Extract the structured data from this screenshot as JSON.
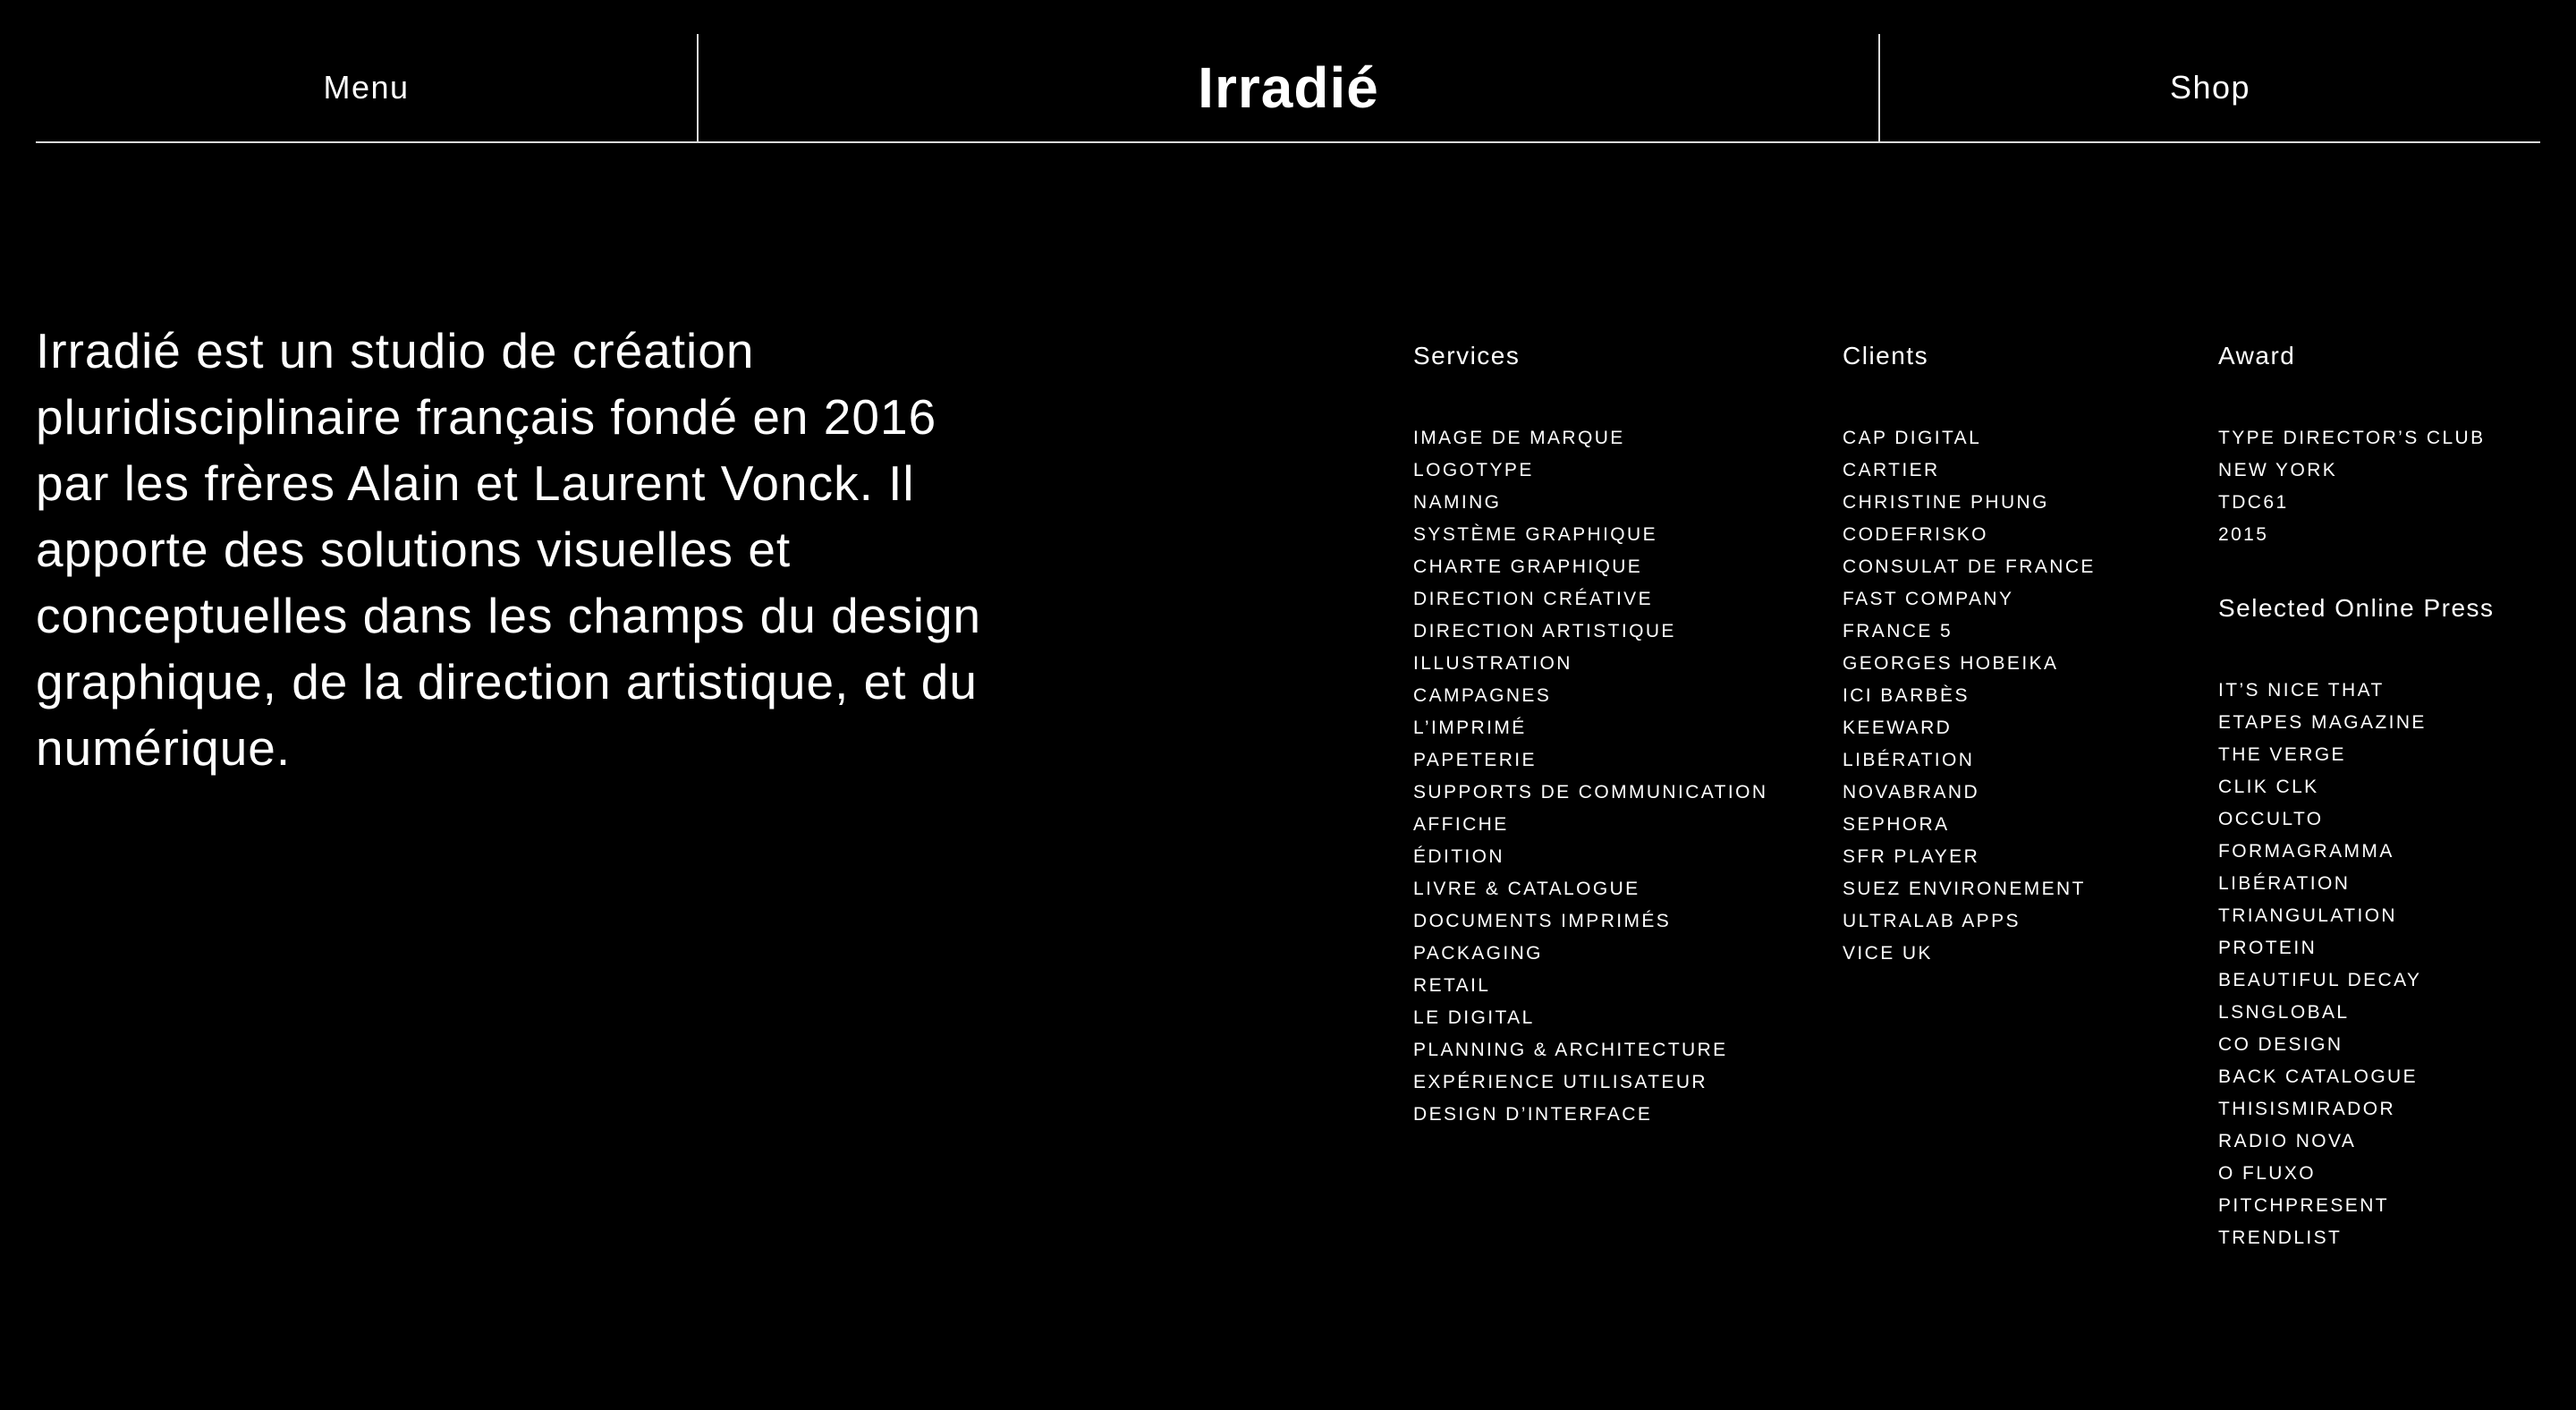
{
  "header": {
    "menu_label": "Menu",
    "logo": "Irradié",
    "shop_label": "Shop"
  },
  "intro": {
    "text": "Irradié est un studio de création pluridisciplinaire français fondé en 2016 par les frères Alain et Laurent Vonck. Il apporte des solutions visuelles et conceptuelles dans les champs du design graphique, de la direction artistique, et du numérique."
  },
  "services": {
    "heading": "Services",
    "groups": [
      [
        "IMAGE DE MARQUE",
        "LOGOTYPE",
        "NAMING",
        "SYSTÈME GRAPHIQUE",
        "CHARTE GRAPHIQUE",
        "DIRECTION CRÉATIVE",
        "DIRECTION ARTISTIQUE",
        "ILLUSTRATION",
        "CAMPAGNES"
      ],
      [
        "L’IMPRIMÉ",
        "PAPETERIE",
        "SUPPORTS DE COMMUNICATION",
        "AFFICHE",
        "ÉDITION",
        "LIVRE & CATALOGUE",
        "DOCUMENTS IMPRIMÉS",
        "PACKAGING",
        "RETAIL"
      ],
      [
        "LE DIGITAL",
        "PLANNING & ARCHITECTURE",
        "EXPÉRIENCE UTILISATEUR",
        "DESIGN D’INTERFACE"
      ]
    ]
  },
  "clients": {
    "heading": "Clients",
    "items": [
      "CAP DIGITAL",
      "CARTIER",
      "CHRISTINE PHUNG",
      "CODEFRISKO",
      "CONSULAT DE FRANCE",
      "FAST COMPANY",
      "FRANCE 5",
      "GEORGES HOBEIKA",
      "ICI BARBÈS",
      "KEEWARD",
      "LIBÉRATION",
      "NOVABRAND",
      "SEPHORA",
      "SFR PLAYER",
      "SUEZ ENVIRONEMENT",
      "ULTRALAB APPS",
      "VICE UK"
    ]
  },
  "award": {
    "heading": "Award",
    "items": [
      "TYPE DIRECTOR’S CLUB",
      "NEW YORK",
      "TDC61",
      "2015"
    ]
  },
  "press": {
    "heading": "Selected Online Press",
    "items": [
      "IT’S NICE THAT",
      "ETAPES MAGAZINE",
      "THE VERGE",
      "CLIK CLK",
      "OCCULTO",
      "FORMAGRAMMA",
      "LIBÉRATION",
      "TRIANGULATION",
      "PROTEIN",
      "BEAUTIFUL DECAY",
      "LSNGLOBAL",
      "CO DESIGN",
      "BACK CATALOGUE",
      "THISISMIRADOR",
      "RADIO NOVA",
      "O FLUXO",
      "PITCHPRESENT",
      "TRENDLIST"
    ]
  }
}
